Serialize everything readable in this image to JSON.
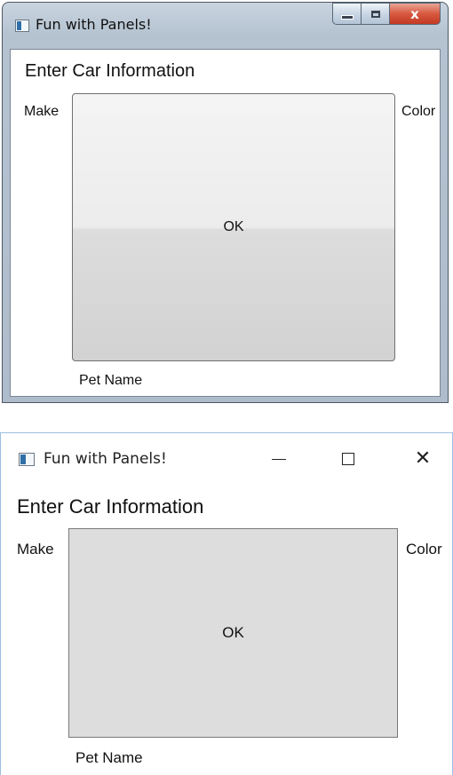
{
  "windows": [
    {
      "style": "windows-7",
      "title": "Fun with Panels!",
      "caption_buttons": {
        "minimize": "minimize",
        "maximize": "maximize",
        "close": "x"
      },
      "content": {
        "heading": "Enter Car Information",
        "make_label": "Make",
        "color_label": "Color",
        "ok_button": "OK",
        "pet_name_label": "Pet Name"
      }
    },
    {
      "style": "windows-10",
      "title": "Fun with Panels!",
      "caption_buttons": {
        "minimize": "minimize",
        "maximize": "maximize",
        "close": "close"
      },
      "content": {
        "heading": "Enter Car Information",
        "make_label": "Make",
        "color_label": "Color",
        "ok_button": "OK",
        "pet_name_label": "Pet Name"
      }
    }
  ],
  "icons": {
    "app": "window-app-icon",
    "close_glyph_win10": "✕"
  },
  "colors": {
    "win7_close_red": "#c33a22",
    "win10_border_blue": "#9cbfe1",
    "button_gray": "#dddddd"
  }
}
